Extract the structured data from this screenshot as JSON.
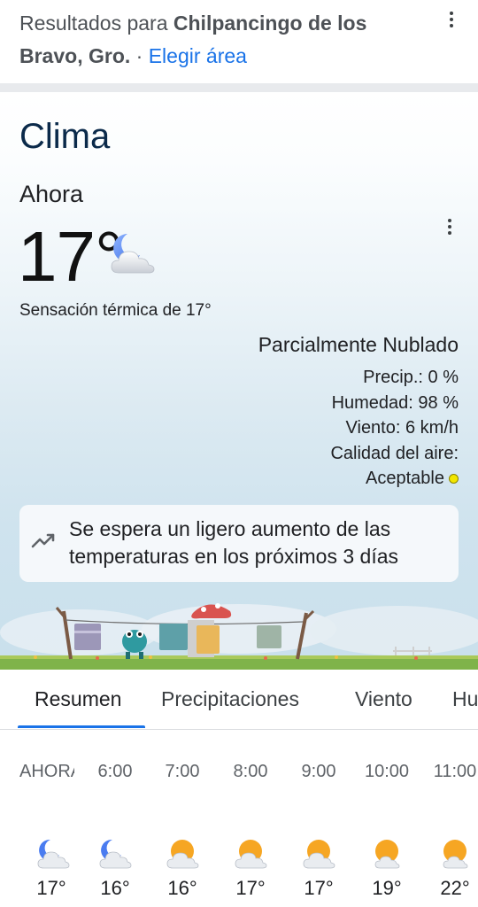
{
  "header": {
    "prefix": "Resultados para ",
    "location": "Chilpancingo de los Bravo, Gro.",
    "separator": " · ",
    "change_area_link": "Elegir área"
  },
  "weather": {
    "title": "Clima",
    "now_label": "Ahora",
    "temperature": "17°",
    "now_icon": "moon-cloud-icon",
    "feels_like": "Sensación térmica de 17°",
    "condition": "Parcialmente Nublado",
    "precip": "Precip.: 0 %",
    "humidity": "Humedad: 98 %",
    "wind": "Viento: 6 km/h",
    "air_quality_label": "Calidad del aire:",
    "air_quality_value": "Aceptable",
    "air_quality_color": "#f2e600",
    "trend_icon": "trending-up-icon",
    "trend_message": "Se espera un ligero aumento de las temperaturas en los próximos 3 días"
  },
  "tabs": [
    {
      "label": "Resumen",
      "active": true
    },
    {
      "label": "Precipitaciones",
      "active": false
    },
    {
      "label": "Viento",
      "active": false
    },
    {
      "label": "Hu",
      "active": false
    }
  ],
  "hourly": [
    {
      "time": "AHORA",
      "temp": "17°",
      "icon": "moon-cloud-icon"
    },
    {
      "time": "6:00",
      "temp": "16°",
      "icon": "moon-cloud-icon"
    },
    {
      "time": "7:00",
      "temp": "16°",
      "icon": "sun-cloud-icon"
    },
    {
      "time": "8:00",
      "temp": "17°",
      "icon": "sun-cloud-icon"
    },
    {
      "time": "9:00",
      "temp": "17°",
      "icon": "sun-cloud-icon"
    },
    {
      "time": "10:00",
      "temp": "19°",
      "icon": "sun-cloud-icon"
    },
    {
      "time": "11:00",
      "temp": "22°",
      "icon": "sun-cloud-icon"
    }
  ],
  "colors": {
    "accent": "#1a73e8",
    "title": "#0b2a4a"
  }
}
